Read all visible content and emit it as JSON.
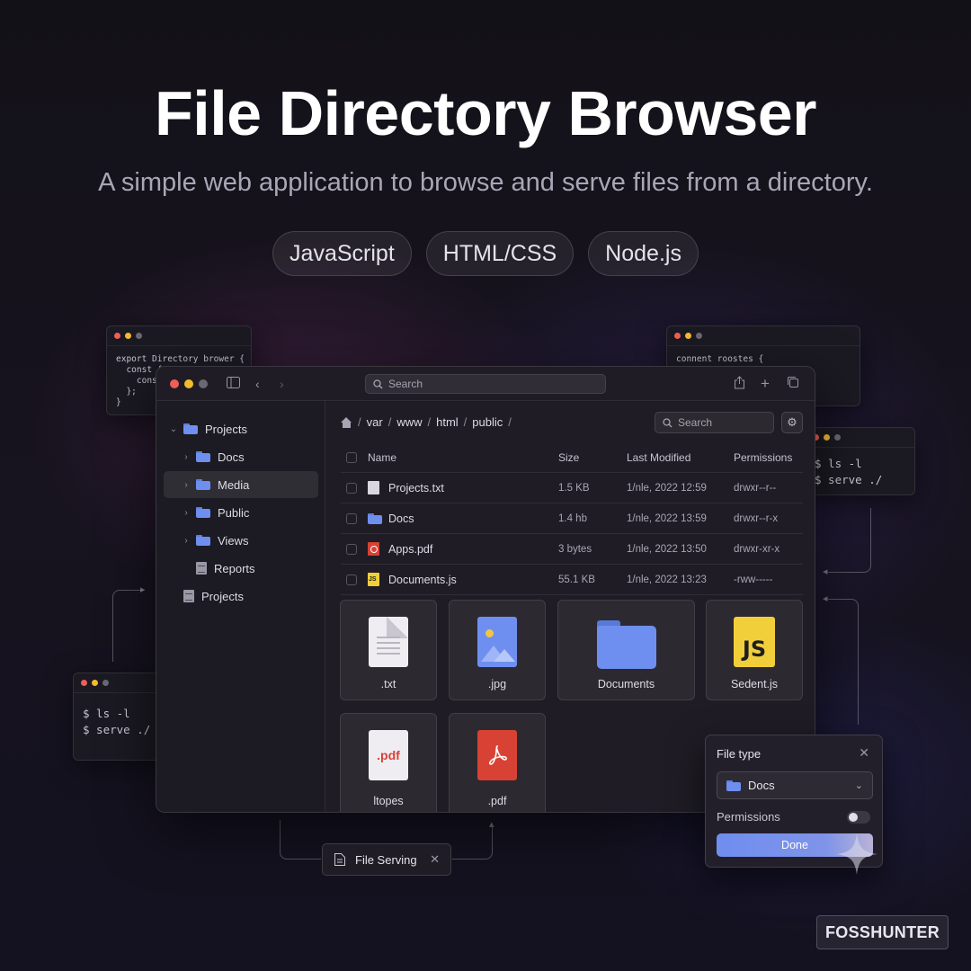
{
  "hero": {
    "title": "File Directory Browser",
    "subtitle": "A simple web application to browse and serve files from a directory.",
    "tags": [
      "JavaScript",
      "HTML/CSS",
      "Node.js"
    ]
  },
  "terminals": {
    "left_code": "export Directory brower {\n  const {\n    cons\n  };\n}",
    "right_code": "connent roostes {",
    "cli_right": "$ ls -l\n$ serve ./",
    "cli_left": "$ ls -l\n$ serve ./"
  },
  "window": {
    "search_placeholder": "Search",
    "sidebar": [
      {
        "label": "Projects",
        "type": "folder",
        "expanded": true
      },
      {
        "label": "Docs",
        "type": "folder"
      },
      {
        "label": "Media",
        "type": "folder",
        "selected": true
      },
      {
        "label": "Public",
        "type": "folder"
      },
      {
        "label": "Views",
        "type": "folder"
      },
      {
        "label": "Reports",
        "type": "doc"
      },
      {
        "label": "Projects",
        "type": "doc"
      }
    ],
    "breadcrumb": [
      "var",
      "www",
      "html",
      "public"
    ],
    "content_search_placeholder": "Search",
    "columns": [
      "Name",
      "Size",
      "Last Modified",
      "Permissions"
    ],
    "files": [
      {
        "name": "Projects.txt",
        "icon": "txt",
        "size": "1.5 KB",
        "modified": "1/nle, 2022 12:59",
        "perms": "drwxr--r--"
      },
      {
        "name": "Docs",
        "icon": "folder",
        "size": "1.4 hb",
        "modified": "1/nle, 2022 13:59",
        "perms": "drwxr--r-x"
      },
      {
        "name": "Apps.pdf",
        "icon": "pdf",
        "size": "3 bytes",
        "modified": "1/nle, 2022 13:50",
        "perms": "drwxr-xr-x"
      },
      {
        "name": "Documents.js",
        "icon": "js",
        "size": "55.1 KB",
        "modified": "1/nle, 2022 13:23",
        "perms": "-rww-----"
      }
    ],
    "tiles": [
      {
        "label": ".txt"
      },
      {
        "label": ".jpg"
      },
      {
        "label": "Documents"
      },
      {
        "label": "Sedent.js"
      },
      {
        "label": "ltopes",
        "badge": ".pdf"
      },
      {
        "label": ".pdf"
      }
    ]
  },
  "popover": {
    "title": "File type",
    "selected": "Docs",
    "permissions_label": "Permissions",
    "done_label": "Done"
  },
  "serving_chip": {
    "label": "File Serving"
  },
  "brand": {
    "label": "FOSSHUNTER"
  },
  "colors": {
    "accent": "#6f8ff0",
    "background": "#15121c",
    "js_yellow": "#f1cf3a",
    "pdf_red": "#d84235"
  }
}
